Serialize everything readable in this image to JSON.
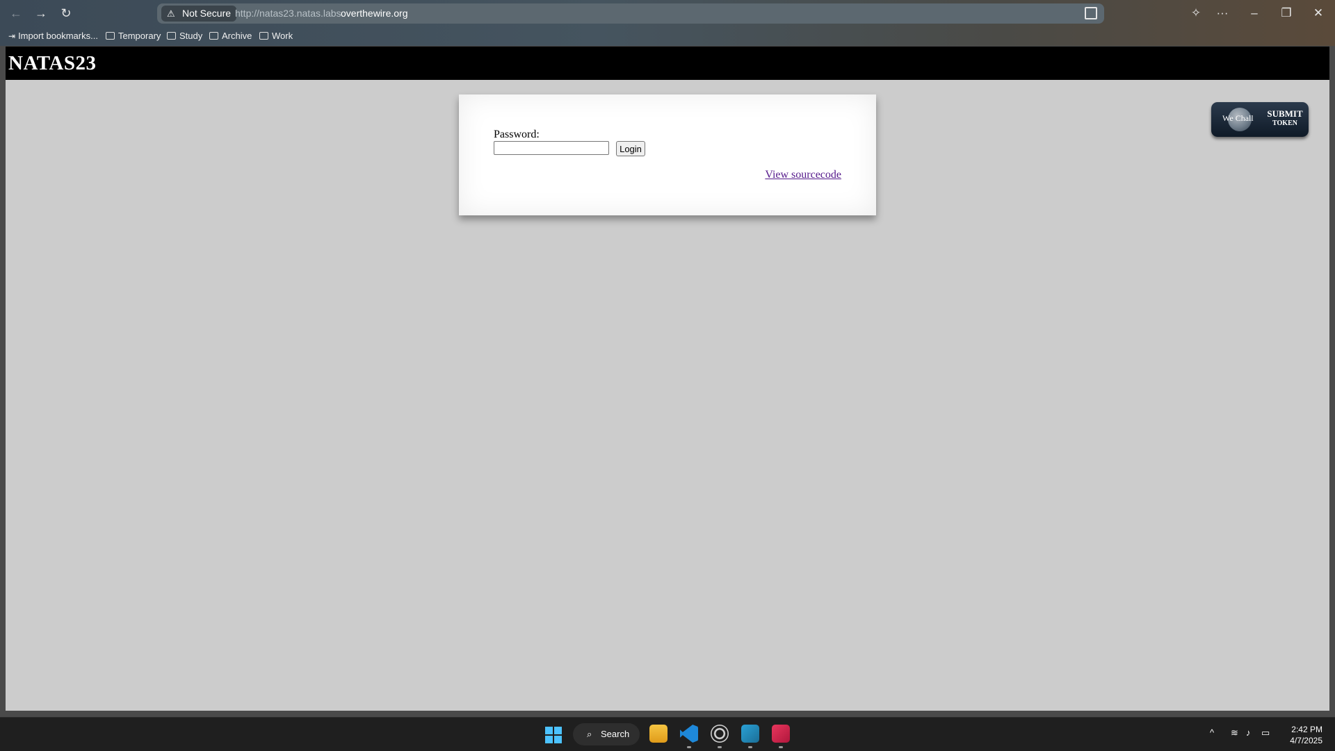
{
  "browser": {
    "security_label": "Not Secure",
    "url_prefix": "http://natas23.natas.labs.",
    "url_domain": "overthewire.org",
    "bookmarks": [
      {
        "label": "Import bookmarks..."
      },
      {
        "label": "Temporary"
      },
      {
        "label": "Study"
      },
      {
        "label": "Archive"
      },
      {
        "label": "Work"
      }
    ]
  },
  "page": {
    "site_title": "NATAS23",
    "password_label": "Password:",
    "password_value": "",
    "login_label": "Login",
    "source_link": "View sourcecode",
    "token_badge": {
      "wechall_text": "We Chall",
      "submit_text": "SUBMIT",
      "token_text": "TOKEN"
    }
  },
  "taskbar": {
    "search_label": "Search",
    "time": "2:42 PM",
    "date": "4/7/2025",
    "apps": [
      "file-explorer-icon",
      "vscode-icon",
      "obs-icon",
      "visual-studio-icon",
      "pinned-app-icon"
    ]
  },
  "colors": {
    "page_background": "#cccccc",
    "header_background": "#000000",
    "link_visited": "#551a8b",
    "start_blue": "#4cc2ff"
  }
}
